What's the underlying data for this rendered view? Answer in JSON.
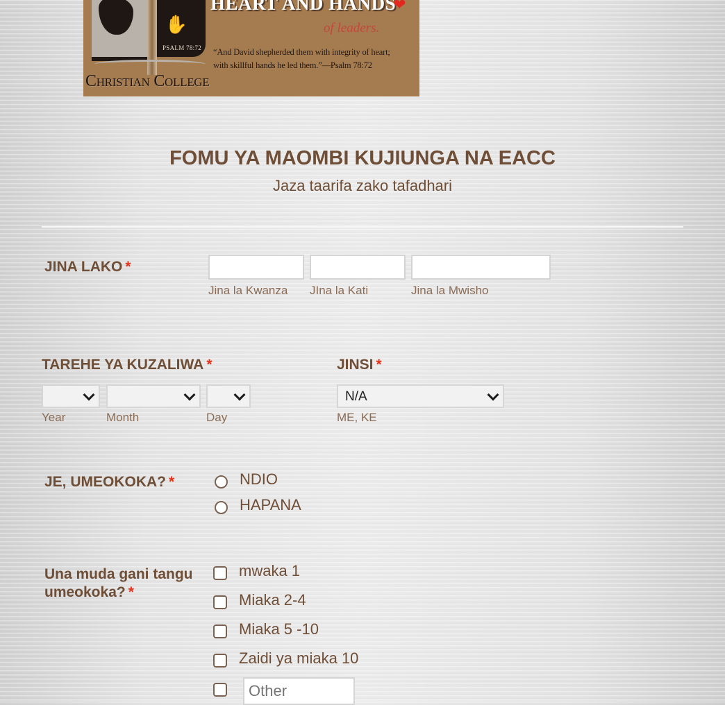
{
  "logo": {
    "headline": "HEART AND HANDS",
    "tagline": "of leaders.",
    "quote_line1": "“And David shepherded them with integrity of heart;",
    "quote_line2": "with skillful hands he led them.”—Psalm 78:72",
    "psalm_badge": "PSALM 78:72",
    "college": "Christian College"
  },
  "header": {
    "title": "FOMU YA MAOMBI KUJIUNGA NA EACC",
    "subtitle": "Jaza taarifa zako tafadhari"
  },
  "required_marker": "*",
  "colors": {
    "text_brown": "#6f4e37",
    "required_red": "#e53219",
    "logo_bg": "#a57b50"
  },
  "name_field": {
    "label": "JINA LAKO",
    "first": {
      "value": "",
      "sublabel": "Jina la Kwanza"
    },
    "middle": {
      "value": "",
      "sublabel": "JIna la Kati"
    },
    "last": {
      "value": "",
      "sublabel": "Jina la Mwisho"
    }
  },
  "birthdate_field": {
    "label": "TAREHE YA KUZALIWA",
    "year": {
      "value": "",
      "sublabel": "Year"
    },
    "month": {
      "value": "",
      "sublabel": "Month"
    },
    "day": {
      "value": "",
      "sublabel": "Day"
    }
  },
  "gender_field": {
    "label": "JINSI",
    "value": "N/A",
    "sublabel": "ME, KE"
  },
  "saved_field": {
    "label": "JE, UMEOKOKA?",
    "options": [
      {
        "label": "NDIO",
        "checked": false
      },
      {
        "label": "HAPANA",
        "checked": false
      }
    ]
  },
  "duration_field": {
    "label_line1": "Una muda gani tangu",
    "label_line2": "umeokoka?",
    "options": [
      {
        "label": "mwaka 1",
        "checked": false
      },
      {
        "label": "Miaka 2-4",
        "checked": false
      },
      {
        "label": "Miaka 5 -10",
        "checked": false
      },
      {
        "label": "Zaidi ya miaka 10",
        "checked": false
      }
    ],
    "other": {
      "checked": false,
      "placeholder": "Other",
      "value": ""
    }
  }
}
